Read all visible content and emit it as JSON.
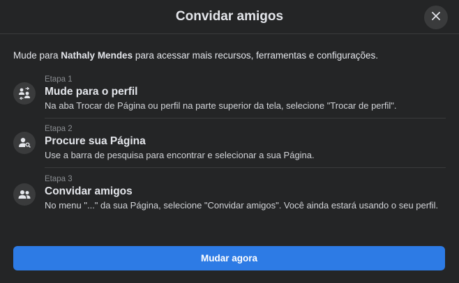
{
  "dialog": {
    "title": "Convidar amigos",
    "close_icon": "close-icon"
  },
  "intro": {
    "prefix": "Mude para ",
    "name": "Nathaly Mendes",
    "suffix": " para acessar mais recursos, ferramentas e configurações."
  },
  "steps": [
    {
      "label": "Etapa 1",
      "title": "Mude para o perfil",
      "description": "Na aba Trocar de Página ou perfil na parte superior da tela, selecione \"Trocar de perfil\".",
      "icon": "switch-profile-icon"
    },
    {
      "label": "Etapa 2",
      "title": "Procure sua Página",
      "description": "Use a barra de pesquisa para encontrar e selecionar a sua Página.",
      "icon": "person-search-icon"
    },
    {
      "label": "Etapa 3",
      "title": "Convidar amigos",
      "description": "No menu \"...\" da sua Página, selecione \"Convidar amigos\". Você ainda estará usando o seu perfil.",
      "icon": "friends-icon"
    }
  ],
  "cta": {
    "label": "Mudar agora"
  },
  "colors": {
    "background": "#242526",
    "icon_bg": "#3a3b3c",
    "divider": "#3a3b3c",
    "primary_button": "#2d7be5",
    "muted_text": "#8a8d91"
  }
}
